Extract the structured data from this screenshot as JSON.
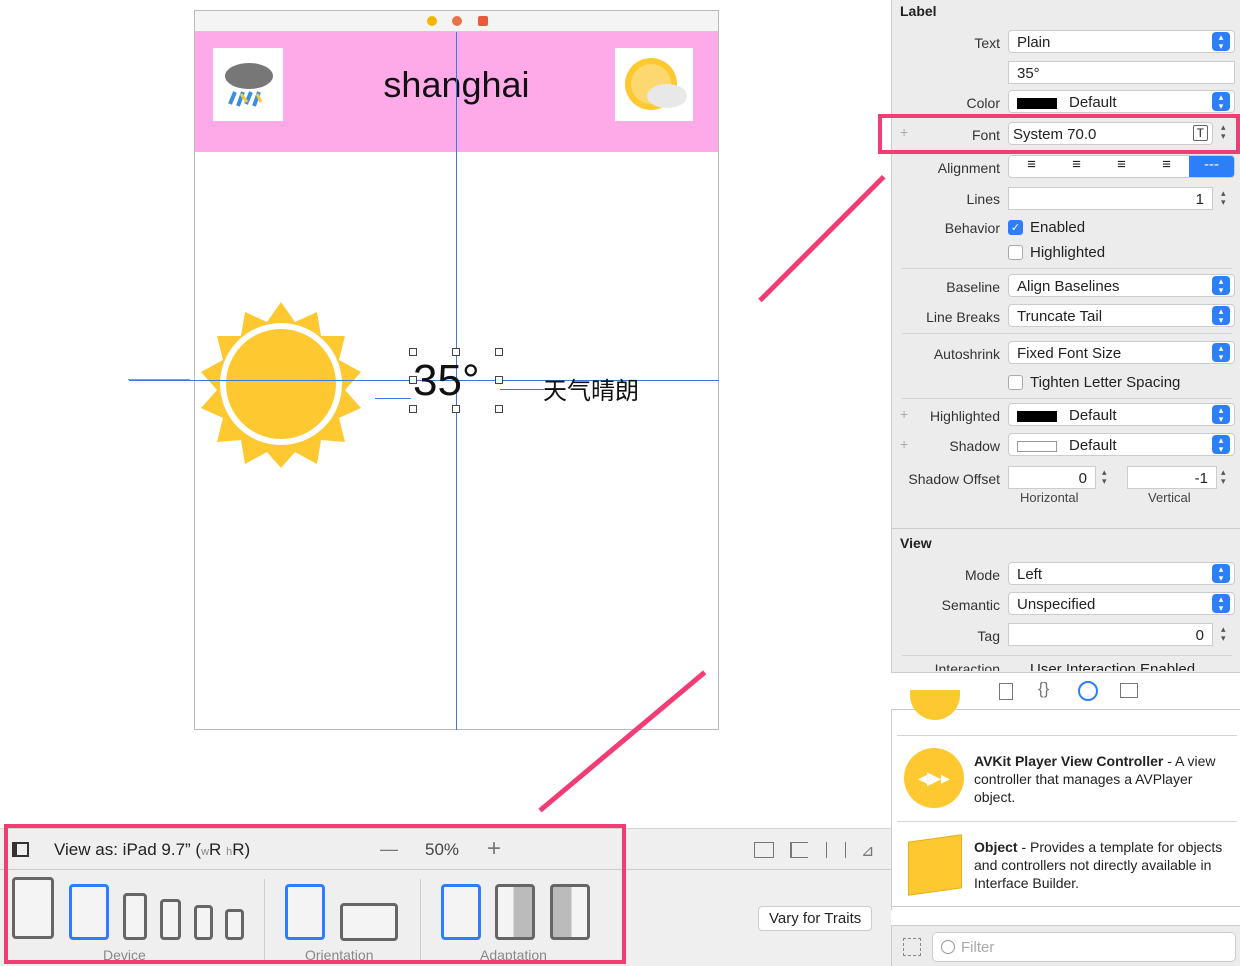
{
  "canvas": {
    "city": "shanghai",
    "temperature": "35°",
    "description": "天气晴朗"
  },
  "bottom_bar": {
    "view_as": "View as: iPad 9.7” (",
    "w": "w",
    "r1": "R",
    "h": "h",
    "r2": "R)",
    "zoom": "50%",
    "zoom_out": "—",
    "zoom_in": "+",
    "groups": [
      "Device",
      "Orientation",
      "Adaptation"
    ],
    "vary_button": "Vary for Traits"
  },
  "inspector": {
    "label_section": "Label",
    "text": {
      "label": "Text",
      "value": "Plain"
    },
    "text_value": "35°",
    "color": {
      "label": "Color",
      "value": "Default"
    },
    "font": {
      "label": "Font",
      "value": "System 70.0"
    },
    "alignment": {
      "label": "Alignment"
    },
    "lines": {
      "label": "Lines",
      "value": "1"
    },
    "behavior": {
      "label": "Behavior",
      "enabled": "Enabled",
      "highlighted": "Highlighted",
      "enabled_checked": true,
      "highlighted_checked": false
    },
    "baseline": {
      "label": "Baseline",
      "value": "Align Baselines"
    },
    "line_breaks": {
      "label": "Line Breaks",
      "value": "Truncate Tail"
    },
    "autoshrink": {
      "label": "Autoshrink",
      "value": "Fixed Font Size",
      "tighten": "Tighten Letter Spacing"
    },
    "highlighted": {
      "label": "Highlighted",
      "value": "Default"
    },
    "shadow": {
      "label": "Shadow",
      "value": "Default"
    },
    "shadow_offset": {
      "label": "Shadow Offset",
      "h": "0",
      "v": "-1",
      "h_label": "Horizontal",
      "v_label": "Vertical"
    },
    "view_section": "View",
    "mode": {
      "label": "Mode",
      "value": "Left"
    },
    "semantic": {
      "label": "Semantic",
      "value": "Unspecified"
    },
    "tag": {
      "label": "Tag",
      "value": "0"
    },
    "interaction": {
      "label": "Interaction",
      "value": "User Interaction Enabled"
    }
  },
  "library": {
    "items": [
      {
        "title": "AVKit Player View Controller",
        "desc": " - A view controller that manages a AVPlayer object."
      },
      {
        "title": "Object",
        "desc": " - Provides a template for objects and controllers not directly available in Interface Builder."
      }
    ],
    "filter_placeholder": "Filter"
  },
  "colors": {
    "accent": "#2d7ff9",
    "highlight": "#f23d74",
    "header": "#ffaae8",
    "sun": "#fdc830"
  }
}
